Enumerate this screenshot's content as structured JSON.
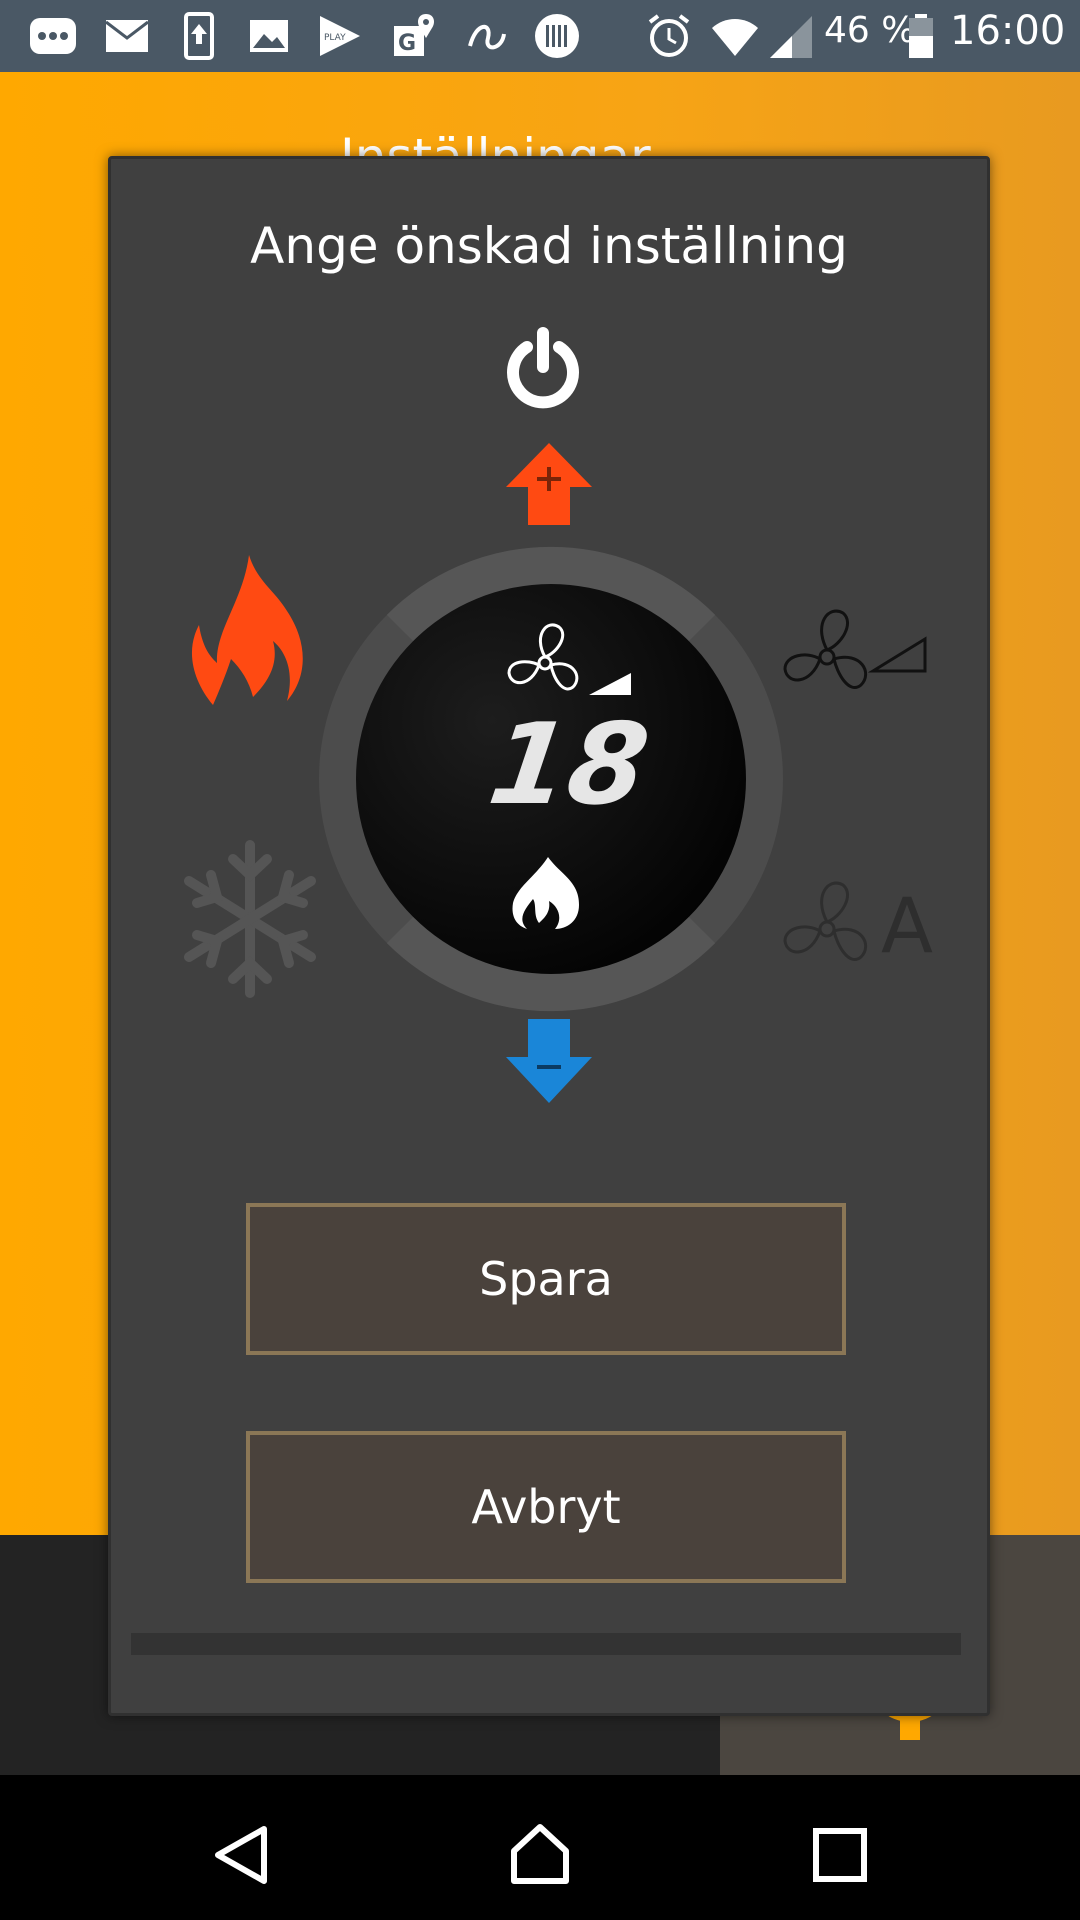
{
  "status_bar": {
    "icons": [
      "more-icon",
      "mail-icon",
      "upload-icon",
      "image-icon",
      "play-store-icon",
      "maps-icon",
      "swirl-icon",
      "barcode-icon",
      "alarm-icon",
      "wifi-icon",
      "signal-icon",
      "battery-icon"
    ],
    "battery_percent": "46 %",
    "time": "16:00"
  },
  "background_app": {
    "title_peek": "Inställningar",
    "colors": {
      "accent": "#ffa800",
      "tab_bg": "#232323",
      "active_tab_bg": "#4b4640"
    }
  },
  "dialog": {
    "title": "Ange önskad inställning",
    "temperature": "18",
    "icons": {
      "power": "power-icon",
      "increase": "plus-arrow-up-icon",
      "decrease": "minus-arrow-down-icon",
      "heat_mode": "flame-icon",
      "cool_mode": "snowflake-icon",
      "fan_speed": "fan-speed-icon",
      "fan_auto": "fan-auto-icon",
      "current_fan": "fan-icon",
      "current_mode": "flame-small-icon"
    },
    "fan_auto_label": "A",
    "save_label": "Spara",
    "cancel_label": "Avbryt",
    "colors": {
      "heat": "#ff4a12",
      "up_arrow": "#ff4a12",
      "down_arrow": "#1a86d8",
      "button_border": "#8b7756"
    }
  },
  "navbar": {
    "icons": [
      "back-icon",
      "home-icon",
      "recents-icon"
    ]
  }
}
